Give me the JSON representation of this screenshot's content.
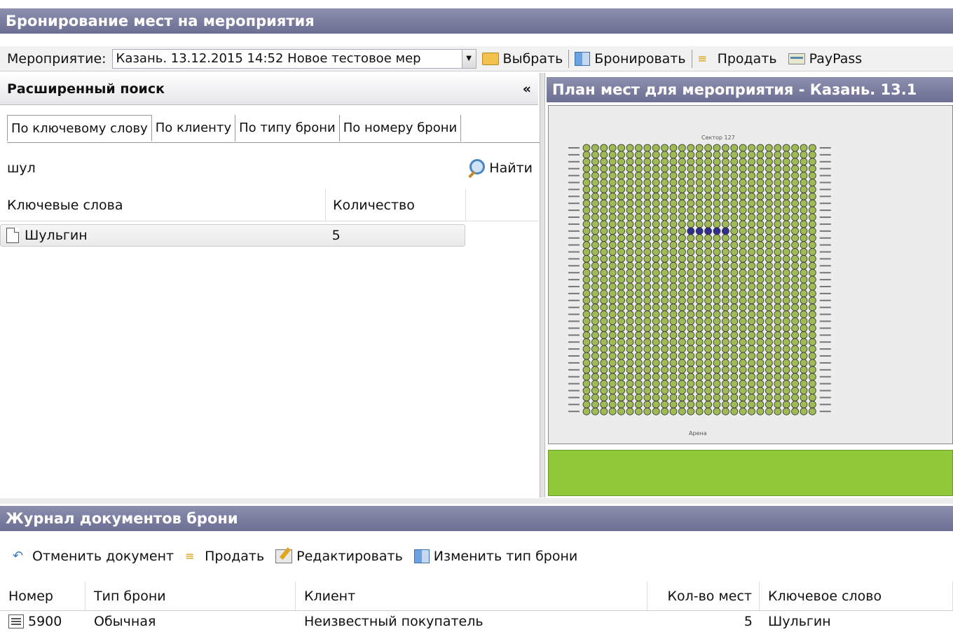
{
  "main_title": "Бронирование мест на мероприятия",
  "toolbar": {
    "event_label": "Мероприятие:",
    "event_value": "Казань. 13.12.2015 14:52 Новое тестовое мер",
    "select_label": "Выбрать",
    "book_label": "Бронировать",
    "sell_label": "Продать",
    "paypass_label": "PayPass"
  },
  "search_panel": {
    "title": "Расширенный поиск",
    "collapse_glyph": "«",
    "tabs": [
      "По ключевому слову",
      "По клиенту",
      "По типу брони",
      "По номеру брони"
    ],
    "query_value": "шул",
    "find_label": "Найти",
    "columns": [
      "Ключевые слова",
      "Количество"
    ],
    "rows": [
      {
        "keyword": "Шульгин",
        "count": "5"
      }
    ]
  },
  "plan": {
    "title": "План мест для мероприятия - Казань. 13.1",
    "sector_label": "Сектор 127",
    "bottom_label": "Арена",
    "rows": 39,
    "seats_per_row": 27,
    "selected_row": 12,
    "selected_seats": [
      12,
      13,
      14,
      15,
      16
    ],
    "seat_color": "#9fbc54",
    "selected_color": "#2e2f8f"
  },
  "journal": {
    "title": "Журнал документов брони",
    "actions": {
      "cancel": "Отменить документ",
      "sell": "Продать",
      "edit": "Редактировать",
      "change_type": "Изменить тип брони"
    },
    "columns": [
      "Номер",
      "Тип брони",
      "Клиент",
      "Кол-во мест",
      "Ключевое слово"
    ],
    "rows": [
      {
        "number": "5900",
        "type": "Обычная",
        "client": "Неизвестный покупатель",
        "seats": "5",
        "keyword": "Шульгин"
      }
    ]
  }
}
